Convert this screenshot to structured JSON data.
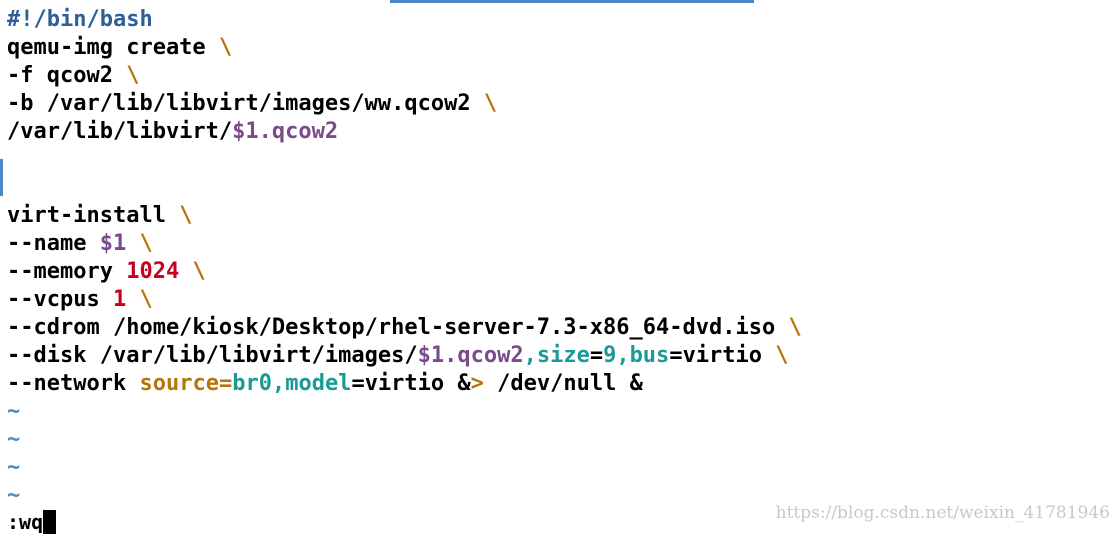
{
  "editor": {
    "line1": {
      "text": "#!/bin/bash"
    },
    "line2": {
      "cmd": "qemu-img create",
      "cont": "\\"
    },
    "line3": {
      "opt": "-f qcow2",
      "cont": "\\"
    },
    "line4": {
      "opt": "-b /var/lib/libvirt/images/ww.qcow2",
      "cont": "\\"
    },
    "line5": {
      "path": "/var/lib/libvirt/",
      "var": "$1.qcow2"
    },
    "line8": {
      "cmd": "virt-install",
      "cont": "\\"
    },
    "line9": {
      "opt": "--name",
      "var": "$1",
      "cont": "\\"
    },
    "line10": {
      "opt": "--memory",
      "num": "1024",
      "cont": "\\"
    },
    "line11": {
      "opt": "--vcpus",
      "num": "1",
      "cont": "\\"
    },
    "line12": {
      "opt": "--cdrom /home/kiosk/Desktop/rhel-server-7.3-x86_64-dvd.iso",
      "cont": "\\"
    },
    "line13": {
      "opt": "--disk /var/lib/libvirt/images/",
      "var": "$1.qcow2",
      "comma1": ",",
      "key1": "size",
      "eq1": "=",
      "val1": "9",
      "comma2": ",",
      "key2": "bus",
      "eq2": "=",
      "val2": "virtio",
      "cont": "\\"
    },
    "line14": {
      "opt": "--network",
      "key1": "source",
      "eq1": "=",
      "val1": "br0",
      "comma": ",",
      "key2": "model",
      "eq2": "=",
      "val2": "virtio",
      "redirect_amp": "&",
      "redirect_gt": ">",
      "rest": "/dev/null &"
    },
    "tilde": "~"
  },
  "command_line": {
    "text": ":wq"
  },
  "watermark": {
    "text": "https://blog.csdn.net/weixin_41781946"
  },
  "colors": {
    "shebang": "#2e5f96",
    "continuation": "#b8740a",
    "variable": "#7a4a8b",
    "number": "#c8001d",
    "keyword": "#1a9a96",
    "tilde": "#4f86be",
    "accent": "#4a88c7"
  }
}
